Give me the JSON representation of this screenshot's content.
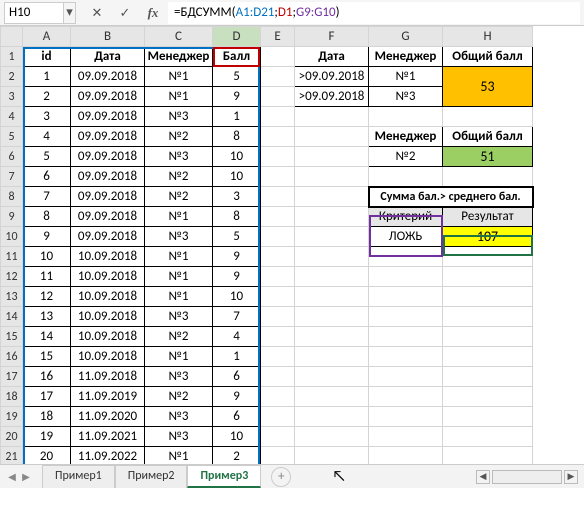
{
  "name_box": "H10",
  "formula": {
    "prefix": "=БДСУММ(",
    "arg1": "A1:D21",
    "arg2": "D1",
    "arg3": "G9:G10",
    "suffix": ")"
  },
  "columns": [
    "A",
    "B",
    "C",
    "D",
    "E",
    "F",
    "G",
    "H"
  ],
  "main": {
    "headers": {
      "A": "id",
      "B": "Дата",
      "C": "Менеджер",
      "D": "Балл"
    },
    "rows": [
      {
        "id": "1",
        "date": "09.09.2018",
        "mgr": "№1",
        "score": "5"
      },
      {
        "id": "2",
        "date": "09.09.2018",
        "mgr": "№1",
        "score": "9"
      },
      {
        "id": "3",
        "date": "09.09.2018",
        "mgr": "№3",
        "score": "1"
      },
      {
        "id": "4",
        "date": "09.09.2018",
        "mgr": "№2",
        "score": "8"
      },
      {
        "id": "5",
        "date": "09.09.2018",
        "mgr": "№3",
        "score": "10"
      },
      {
        "id": "6",
        "date": "09.09.2018",
        "mgr": "№2",
        "score": "10"
      },
      {
        "id": "7",
        "date": "09.09.2018",
        "mgr": "№2",
        "score": "3"
      },
      {
        "id": "8",
        "date": "09.09.2018",
        "mgr": "№1",
        "score": "8"
      },
      {
        "id": "9",
        "date": "09.09.2018",
        "mgr": "№3",
        "score": "5"
      },
      {
        "id": "10",
        "date": "10.09.2018",
        "mgr": "№1",
        "score": "9"
      },
      {
        "id": "11",
        "date": "10.09.2018",
        "mgr": "№1",
        "score": "9"
      },
      {
        "id": "12",
        "date": "10.09.2018",
        "mgr": "№1",
        "score": "10"
      },
      {
        "id": "13",
        "date": "10.09.2018",
        "mgr": "№3",
        "score": "7"
      },
      {
        "id": "14",
        "date": "10.09.2018",
        "mgr": "№2",
        "score": "4"
      },
      {
        "id": "15",
        "date": "10.09.2018",
        "mgr": "№1",
        "score": "1"
      },
      {
        "id": "16",
        "date": "11.09.2018",
        "mgr": "№3",
        "score": "6"
      },
      {
        "id": "17",
        "date": "11.09.2019",
        "mgr": "№2",
        "score": "9"
      },
      {
        "id": "18",
        "date": "11.09.2020",
        "mgr": "№3",
        "score": "6"
      },
      {
        "id": "19",
        "date": "11.09.2021",
        "mgr": "№3",
        "score": "10"
      },
      {
        "id": "20",
        "date": "11.09.2022",
        "mgr": "№1",
        "score": "2"
      }
    ]
  },
  "criteria1": {
    "headers": {
      "F": "Дата",
      "G": "Менеджер",
      "H": "Общий балл"
    },
    "rows": [
      {
        "F": ">09.09.2018",
        "G": "№1"
      },
      {
        "F": ">09.09.2018",
        "G": "№3"
      }
    ],
    "result": "53"
  },
  "criteria2": {
    "headers": {
      "G": "Менеджер",
      "H": "Общий балл"
    },
    "row": {
      "G": "№2"
    },
    "result": "51"
  },
  "criteria3": {
    "span_header": "Сумма бал.> среднего бал.",
    "crit_label": "Критерий",
    "res_label": "Результат",
    "crit_value": "ЛОЖЬ",
    "res_value": "107"
  },
  "tabs": {
    "t1": "Пример1",
    "t2": "Пример2",
    "t3": "Пример3"
  },
  "icons": {
    "cancel": "✕",
    "enter": "✓",
    "fx": "fx",
    "dd": "▾",
    "nav_l": "◀",
    "nav_r": "▶",
    "plus": "+"
  }
}
